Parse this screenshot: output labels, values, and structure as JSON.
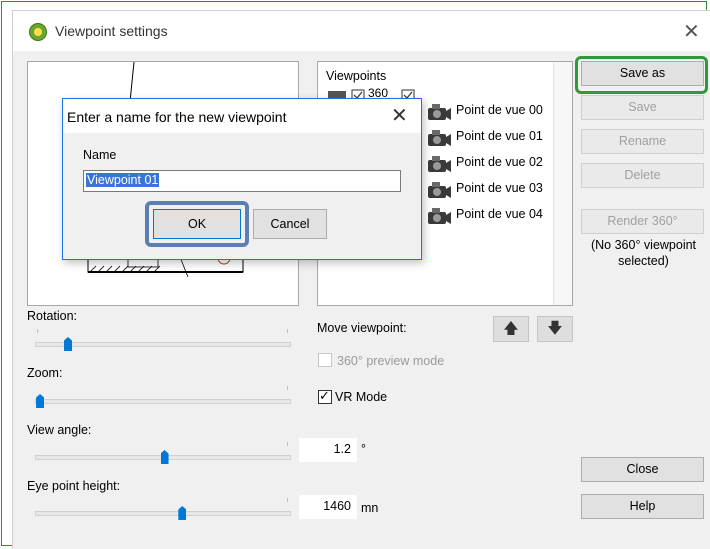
{
  "window": {
    "title": "Viewpoint settings",
    "close_glyph": "✕"
  },
  "viewpoints": {
    "title": "Viewpoints",
    "badge_360": "360",
    "items": [
      {
        "label": "Point de vue 00"
      },
      {
        "label": "Point de vue 01"
      },
      {
        "label": "Point de vue 02"
      },
      {
        "label": "Point de vue 03"
      },
      {
        "label": "Point de vue 04"
      }
    ]
  },
  "buttons": {
    "save_as": "Save as",
    "save": "Save",
    "rename": "Rename",
    "delete": "Delete",
    "render360": "Render 360°",
    "close": "Close",
    "help": "Help"
  },
  "no360_note": "(No 360° viewpoint selected)",
  "controls": {
    "rotation_label": "Rotation:",
    "zoom_label": "Zoom:",
    "view_angle_label": "View angle:",
    "eye_height_label": "Eye point height:",
    "move_viewpoint_label": "Move viewpoint:",
    "preview360_label": "360° preview mode",
    "vr_mode_label": "VR Mode",
    "view_angle_value": "1.2",
    "view_angle_unit": "°",
    "eye_height_value": "1460",
    "eye_height_unit": "mn",
    "rotation_level": 0.13,
    "zoom_level": 0.02,
    "view_angle_level": 0.51,
    "eye_height_level": 0.58,
    "vr_mode_checked": true,
    "preview360_checked": false,
    "up_arrow": "🡅",
    "down_arrow": "🡇"
  },
  "dialog": {
    "title": "Enter a name for the new viewpoint",
    "close_glyph": "✕",
    "name_label": "Name",
    "name_value": "Viewpoint 01",
    "ok": "OK",
    "cancel": "Cancel"
  },
  "colors": {
    "highlight_green": "#2e9b3a",
    "ok_ring_blue": "#5b7fb2",
    "selection_blue": "#3875d7",
    "slider_blue": "#0078d7"
  }
}
